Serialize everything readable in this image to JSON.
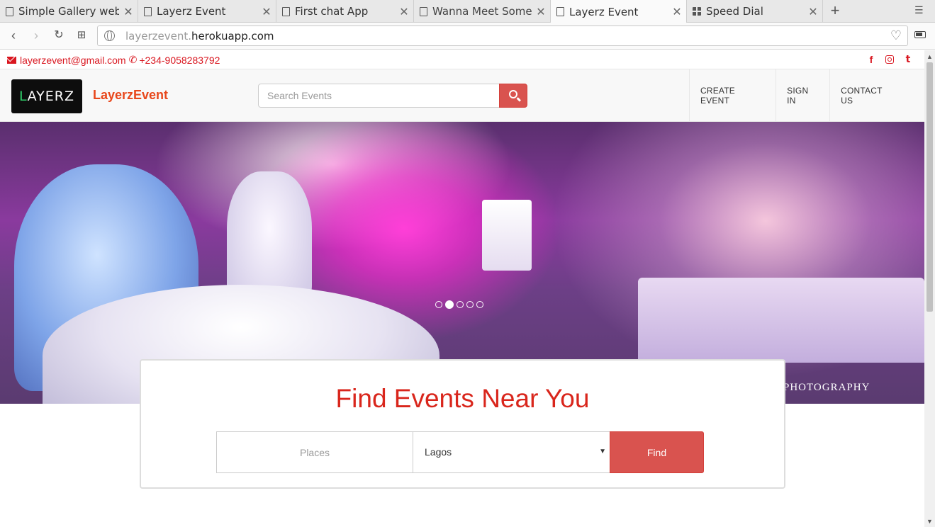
{
  "browser": {
    "tabs": [
      {
        "title": "Simple Gallery websi"
      },
      {
        "title": "Layerz Event"
      },
      {
        "title": "First chat App"
      },
      {
        "title": "Wanna Meet Someo"
      },
      {
        "title": "Layerz Event"
      },
      {
        "title": "Speed Dial"
      }
    ],
    "active_tab": 4,
    "url_prefix": "layerzevent.",
    "url_domain": "herokuapp.com"
  },
  "topbar": {
    "email": "layerzevent@gmail.com",
    "phone": "+234-9058283792",
    "social": [
      "f",
      "t"
    ]
  },
  "header": {
    "logo_text": "AYERZ",
    "logo_letter": "L",
    "brand": "LayerzEvent",
    "search_placeholder": "Search Events",
    "menu": [
      "CREATE EVENT",
      "SIGN IN",
      "CONTACT US"
    ]
  },
  "hero": {
    "watermark": "PHOTOGRAPHY",
    "slide_count": 5,
    "active_slide": 2
  },
  "find": {
    "title": "Find Events Near You",
    "places_placeholder": "Places",
    "city_selected": "Lagos",
    "button": "Find"
  },
  "colors": {
    "accent": "#d9534f",
    "brand": "#e8471b",
    "heading": "#d9261c"
  }
}
